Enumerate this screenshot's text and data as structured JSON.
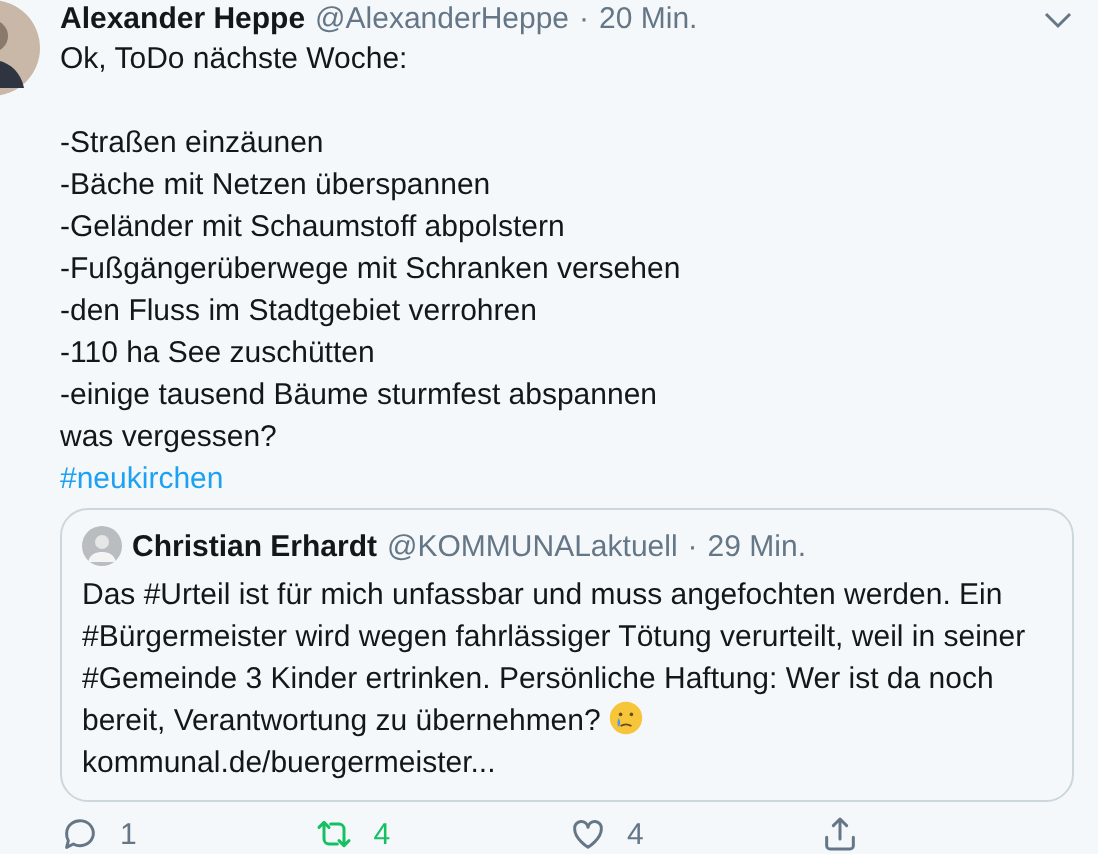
{
  "tweet": {
    "name": "Alexander Heppe",
    "handle": "@AlexanderHeppe",
    "separator": "·",
    "time": "20 Min.",
    "paragraphs": [
      {
        "lines": [
          "Ok, ToDo nächste Woche:"
        ]
      },
      {
        "lines": [
          "-Straßen einzäunen",
          "-Bäche mit Netzen überspannen",
          "-Geländer mit Schaumstoff abpolstern",
          "-Fußgängerüberwege mit Schranken versehen",
          "-den Fluss im Stadtgebiet verrohren",
          "-110 ha See zuschütten",
          "-einige tausend Bäume sturmfest abspannen",
          "was vergessen?"
        ]
      }
    ],
    "hashtag": "#neukirchen",
    "quote": {
      "name": "Christian Erhardt",
      "handle": "@KOMMUNALaktuell",
      "separator": "·",
      "time": "29 Min.",
      "text": "Das #Urteil ist für mich unfassbar und muss angefochten werden. Ein #Bürgermeister wird wegen fahrlässiger Tötung verurteilt, weil in seiner #Gemeinde 3 Kinder ertrinken. Persönliche Haftung: Wer ist da noch bereit, Verantwortung zu übernehmen?",
      "link": "kommunal.de/buergermeister..."
    },
    "actions": [
      {
        "kind": "reply",
        "count": "1",
        "active": false
      },
      {
        "kind": "retweet",
        "count": "4",
        "active": true
      },
      {
        "kind": "like",
        "count": "4",
        "active": false
      },
      {
        "kind": "share",
        "active": false
      }
    ]
  }
}
